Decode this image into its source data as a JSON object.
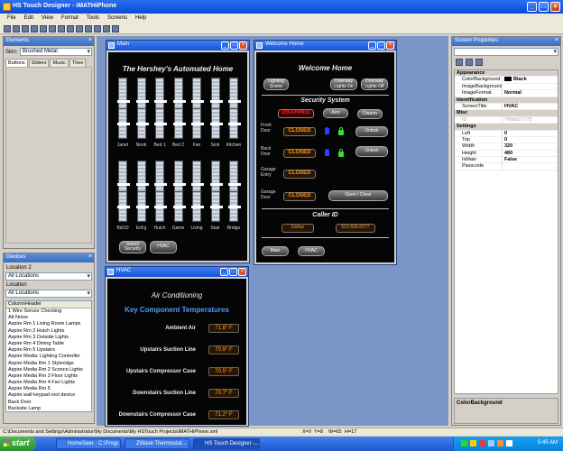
{
  "app": {
    "title": "HS Touch Designer - iMATHiPhone",
    "menu": [
      "File",
      "Edit",
      "View",
      "Format",
      "Tools",
      "Screens",
      "Help"
    ]
  },
  "elements_panel": {
    "title": "Elements",
    "skin_label": "Skin:",
    "skin_value": "Brushed Metal",
    "tabs": [
      "Buttons",
      "Sliders",
      "Music",
      "Thee"
    ]
  },
  "devices_panel": {
    "title": "Devices",
    "location2_label": "Location 2",
    "location2_value": "All Locations",
    "location_label": "Location",
    "location_value": "All Locations",
    "column_header": "ColumnHeader",
    "items": [
      "1 Wire Sensor Checking",
      "Alt Noise",
      "Aspire Rm 1 Living Room Lamps",
      "Aspire Rm 2 Hutch Lights",
      "Aspire Rm 3 Outside Lights",
      "Aspire Rm 4 Dining Table",
      "Aspire Rm 5 Upstairs",
      "Aspire Media: Lighting Controller",
      "Aspire Media Rm 1 Styleridge",
      "Aspire Media Rm 2 Sconce Lights",
      "Aspire Media Rm 3 Floor Lights",
      "Aspire Media Rm 4 Fan Lights",
      "Aspire Media Rm 5",
      "Aspire wall keypad root device",
      "Back Door",
      "Backsite Lamp"
    ]
  },
  "main_screen": {
    "window_title": "Main",
    "heading": "The Hershey's Automated Home",
    "row1_labels": [
      "Janet",
      "Nook",
      "Bed 1",
      "Bed 2",
      "Fan",
      "Sink",
      "Kitchen"
    ],
    "row2_labels": [
      "Bd/10",
      "Ent'g",
      "Hutch",
      "Game",
      "Living",
      "Stair",
      "Bridge"
    ],
    "btn_security": "Select Security",
    "btn_hvac": "HVAC"
  },
  "welcome_screen": {
    "window_title": "Welcome Home",
    "heading": "Welcome Home",
    "btn_lighting": "Lighting Scene",
    "btn_lights_on": "Doorway Lights On",
    "btn_lights_off": "Doorway Lights Off",
    "security_heading": "Security System",
    "disarmed": "DISARMED",
    "btn_arm": "Arm",
    "btn_disarm": "Disarm",
    "front_door_label": "Front Door",
    "front_door_status": "CLOSED",
    "btn_unlock": "Unlock",
    "back_door_label": "Back Door",
    "back_door_status": "CLOSED",
    "btn_unlock2": "Unlock",
    "garage_entry_label": "Garage Entry",
    "garage_entry_status": "CLOSED",
    "garage_door_label": "Garage Door",
    "garage_door_status": "CLOSED",
    "btn_open_close": "Open / Close",
    "caller_id_heading": "Caller ID",
    "caller_name": "Delfas",
    "caller_number": "512-555-0077",
    "btn_main": "Main",
    "btn_hvac": "HVAC"
  },
  "hvac_screen": {
    "window_title": "HVAC",
    "heading": "Air Conditioning",
    "subheading": "Key Component Temperatures",
    "rows": [
      {
        "label": "Ambient Air",
        "value": "71.8° F"
      },
      {
        "label": "Upstairs Suction Line",
        "value": "70.9° F"
      },
      {
        "label": "Upstairs Compressor Case",
        "value": "70.5° F"
      },
      {
        "label": "Downstairs Suction Line",
        "value": "70.7° F"
      },
      {
        "label": "Downstairs Compressor Case",
        "value": "71.2° F"
      }
    ]
  },
  "properties_panel": {
    "title": "Screen Properties",
    "rows": [
      {
        "cat": true,
        "name": "Appearance"
      },
      {
        "name": "ColorBackground",
        "value": "Black",
        "swatch": "#000000"
      },
      {
        "name": "ImageBackground",
        "value": ""
      },
      {
        "name": "ImageFormat",
        "value": "Normal"
      },
      {
        "cat": true,
        "name": "Identification"
      },
      {
        "name": "ScreenTitle",
        "value": "HVAC"
      },
      {
        "cat": true,
        "name": "Misc"
      },
      {
        "name": "ID",
        "value": "7f6fab21775",
        "dim": true
      },
      {
        "cat": true,
        "name": "Settings"
      },
      {
        "name": "Left",
        "value": "0"
      },
      {
        "name": "Top",
        "value": "0"
      },
      {
        "name": "Width",
        "value": "320"
      },
      {
        "name": "Height",
        "value": "480"
      },
      {
        "name": "IsMain",
        "value": "False"
      },
      {
        "name": "Passcode",
        "value": ""
      }
    ],
    "description_title": "ColorBackground"
  },
  "statusbar": {
    "path": "C:\\Documents and Settings\\Administrator\\My Documents\\My HSTouch Projects\\iMATHiPhone.xml",
    "coords": [
      "X=0",
      "Y=8",
      "W=65",
      "H=17"
    ]
  },
  "taskbar": {
    "start": "start",
    "tasks": [
      "HomeSeer - C:\\Progr...",
      "ZWave Thermostat...",
      "HS Touch Designer -..."
    ],
    "clock": "5:45 AM"
  },
  "colors": {
    "accent_blue": "#0a49d6",
    "closed_orange": "#ff9a20",
    "disarmed_red": "#ff2020",
    "hvac_subheading": "#4a9cff"
  }
}
